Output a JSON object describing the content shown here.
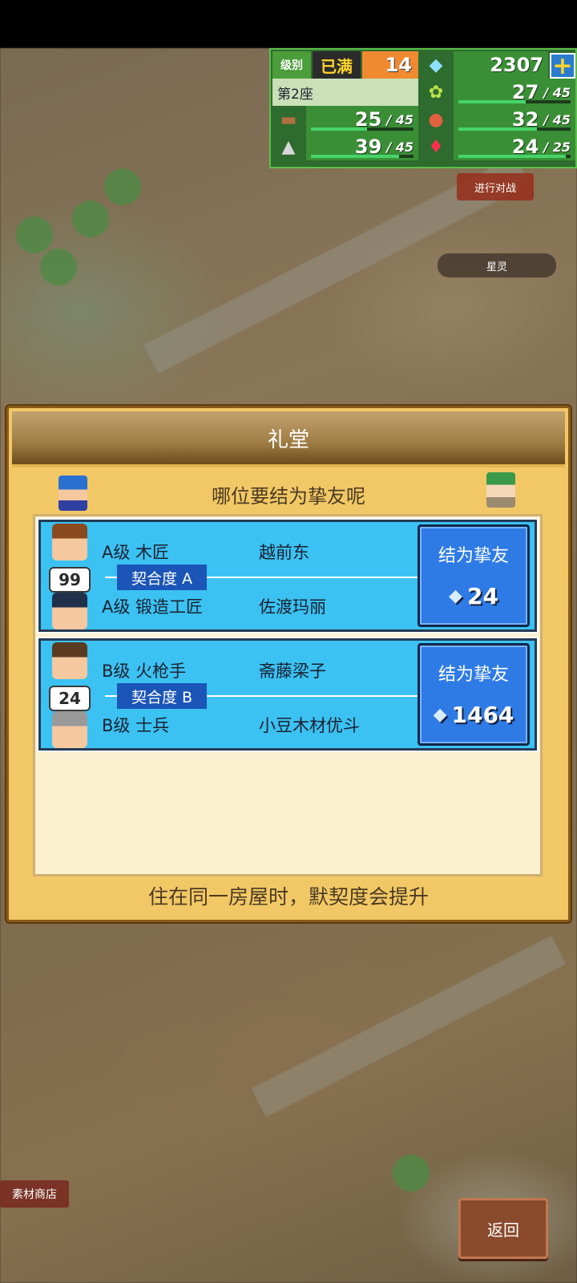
{
  "status": {
    "level_label": "级别",
    "level_badge": "已满",
    "level_value": "14",
    "gems": "2307",
    "seat": "第2座",
    "resources": [
      {
        "icon": "grass-icon",
        "value": "27",
        "max": "45",
        "fill": 0.6
      },
      {
        "icon": "wood-icon",
        "value": "25",
        "max": "45",
        "fill": 0.55
      },
      {
        "icon": "food-icon",
        "value": "32",
        "max": "45",
        "fill": 0.7
      },
      {
        "icon": "stone-icon",
        "value": "39",
        "max": "45",
        "fill": 0.86
      },
      {
        "icon": "ruby-icon",
        "value": "24",
        "max": "25",
        "fill": 0.96
      }
    ]
  },
  "overlay": {
    "battle_button": "进行对战",
    "spirit_label": "星灵"
  },
  "dialog": {
    "title": "礼堂",
    "subtitle": "哪位要结为挚友呢",
    "footer": "住在同一房屋时，默契度会提升",
    "pairs": [
      {
        "compat_score": "99",
        "compat_label": "契合度 A",
        "top_role": "A级 木匠",
        "top_name": "越前东",
        "bottom_role": "A级 锻造工匠",
        "bottom_name": "佐渡玛丽",
        "button_label": "结为挚友",
        "cost": "24"
      },
      {
        "compat_score": "24",
        "compat_label": "契合度 B",
        "top_role": "B级 火枪手",
        "top_name": "斋藤梁子",
        "bottom_role": "B级 士兵",
        "bottom_name": "小豆木材优斗",
        "button_label": "结为挚友",
        "cost": "1464"
      }
    ]
  },
  "bottom": {
    "shop_label": "素材商店",
    "back_label": "返回"
  },
  "colors": {
    "accent_blue": "#3bc2f2",
    "button_blue": "#2f7be6",
    "panel_gold": "#f2c866",
    "status_green": "#3a8f36"
  }
}
